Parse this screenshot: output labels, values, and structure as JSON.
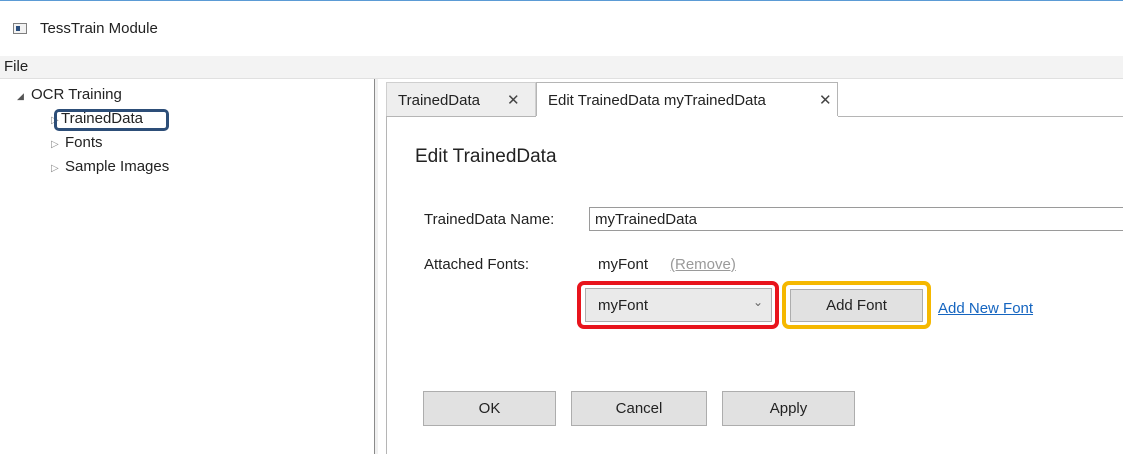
{
  "window": {
    "title": "TessTrain Module"
  },
  "menu": {
    "file_label": "File"
  },
  "tree": {
    "root_label": "OCR Training",
    "items": [
      {
        "label": "TrainedData"
      },
      {
        "label": "Fonts"
      },
      {
        "label": "Sample Images"
      }
    ]
  },
  "tabs": [
    {
      "label": "TrainedData",
      "close": "✕"
    },
    {
      "label": "Edit TrainedData  myTrainedData",
      "close": "✕"
    }
  ],
  "editor": {
    "heading": "Edit TrainedData",
    "name_label": "TrainedData Name:",
    "name_value": "myTrainedData",
    "attached_label": "Attached Fonts:",
    "attached_font": "myFont",
    "remove_label": "(Remove)",
    "font_select_value": "myFont",
    "add_font_label": "Add Font",
    "add_new_font_label": "Add New Font"
  },
  "footer": {
    "ok_label": "OK",
    "cancel_label": "Cancel",
    "apply_label": "Apply"
  },
  "colors": {
    "highlight_tree": "#2d4e78",
    "highlight_select": "#e8141c",
    "highlight_button": "#f5b800",
    "link": "#1565c0"
  }
}
